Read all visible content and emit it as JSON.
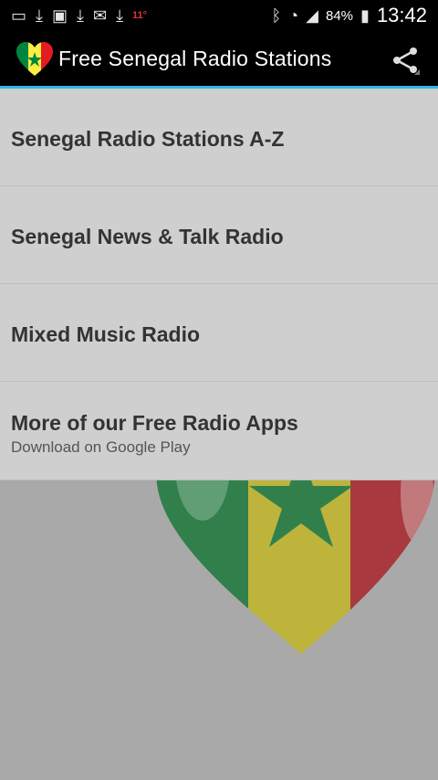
{
  "status_bar": {
    "battery": "84%",
    "time": "13:42",
    "icons": [
      "chat-icon",
      "download-icon",
      "image-icon",
      "download-icon",
      "email-icon",
      "download-icon",
      "temperature-icon",
      "bluetooth-icon",
      "wifi-icon",
      "signal-icon",
      "battery-icon"
    ],
    "temp": "11°"
  },
  "action_bar": {
    "title": "Free Senegal Radio Stations",
    "share_icon": "share-icon"
  },
  "menu": {
    "items": [
      {
        "title": "Senegal Radio Stations A-Z"
      },
      {
        "title": "Senegal News & Talk Radio"
      },
      {
        "title": "Mixed Music Radio"
      },
      {
        "title": "More of our Free Radio Apps",
        "subtitle": "Download on Google Play"
      }
    ]
  },
  "colors": {
    "accent": "#33b5e5",
    "flag_green": "#00853f",
    "flag_yellow": "#fdef42",
    "flag_red": "#e31b23"
  }
}
